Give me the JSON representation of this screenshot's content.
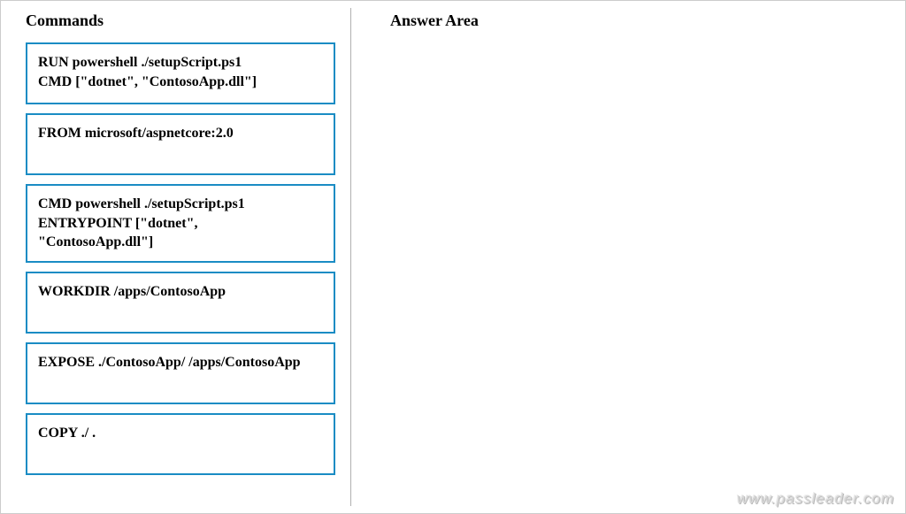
{
  "left": {
    "title": "Commands",
    "boxes": [
      "RUN powershell ./setupScript.ps1\nCMD [\"dotnet\", \"ContosoApp.dll\"]",
      "FROM microsoft/aspnetcore:2.0",
      "CMD powershell ./setupScript.ps1\nENTRYPOINT [\"dotnet\",\n\"ContosoApp.dll\"]",
      "WORKDIR /apps/ContosoApp",
      "EXPOSE ./ContosoApp/ /apps/ContosoApp",
      "COPY ./ ."
    ]
  },
  "right": {
    "title": "Answer Area"
  },
  "watermark": "www.passleader.com"
}
